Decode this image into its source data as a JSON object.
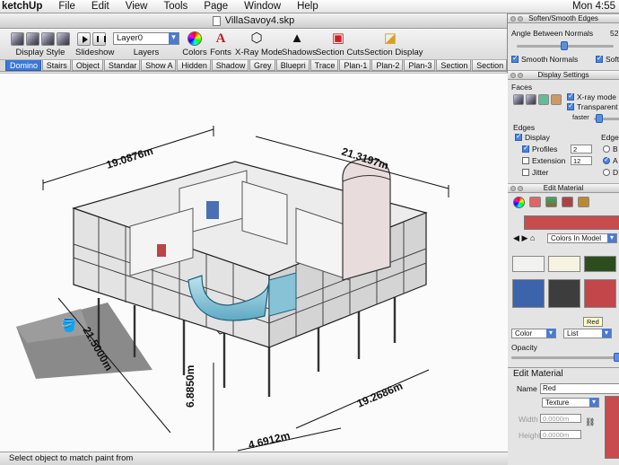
{
  "menubar": {
    "app": "ketchUp",
    "items": [
      "File",
      "Edit",
      "View",
      "Tools",
      "Page",
      "Window",
      "Help"
    ],
    "clock": "Mon 4:55"
  },
  "window": {
    "title": "VillaSavoy4.skp"
  },
  "toolbar": {
    "display_style": "Display Style",
    "slideshow": "Slideshow",
    "layers": "Layers",
    "layer_value": "Layer0",
    "colors": "Colors",
    "fonts": "Fonts",
    "xray": "X-Ray Mode",
    "shadows": "Shadows",
    "section_cuts": "Section Cuts",
    "section_display": "Section Display"
  },
  "scene_tabs": [
    "Domino",
    "Stairs",
    "Object",
    "Standar",
    "Show A",
    "Hidden",
    "Shadow",
    "Grey",
    "Bluepri",
    "Trace",
    "Plan-1",
    "Plan-2",
    "Plan-3",
    "Section",
    "Section"
  ],
  "dimensions": {
    "top": "19.0876m",
    "right_top": "21.3197m",
    "left": "21.5000m",
    "bottom_right": "19.2686m",
    "bottom": "4.6912m",
    "height": "6.8850m"
  },
  "status": "Select object to match paint from",
  "soften": {
    "title": "Soften/Smooth Edges",
    "angle_label": "Angle Between Normals",
    "angle_value": "52",
    "angle_fraction": 0.45,
    "smooth_normals": "Smooth Normals",
    "soften_coplanar": "Softer"
  },
  "display_settings": {
    "title": "Display Settings",
    "faces": "Faces",
    "xray": "X-ray mode",
    "transparency": "Transparent",
    "faster": "faster",
    "edges": "Edges",
    "display": "Display",
    "edge_col": "Edge",
    "profiles": "Profiles",
    "profiles_value": "2",
    "extension": "Extension",
    "extension_value": "12",
    "jitter": "Jitter",
    "opt_b": "B",
    "opt_a": "A",
    "opt_d": "D"
  },
  "edit_material": {
    "title": "Edit Material",
    "library": "Colors In Model",
    "swatches": [
      "#f2f2f0",
      "#f6f3e2",
      "#2d4d1f",
      "#9b8f78",
      "#3c64ad",
      "#3d3d3d",
      "#c2464a",
      "#a9a9a9"
    ],
    "current_color": "#c84b4e",
    "tooltip": "Red",
    "color_dd": "Color",
    "list_dd": "List",
    "opacity": "Opacity",
    "section": "Edit Material",
    "name_label": "Name",
    "name_value": "Red",
    "texture": "Texture",
    "width_label": "Width",
    "width_value": "0.0000m",
    "height_label": "Height",
    "height_value": "0.0000m"
  }
}
